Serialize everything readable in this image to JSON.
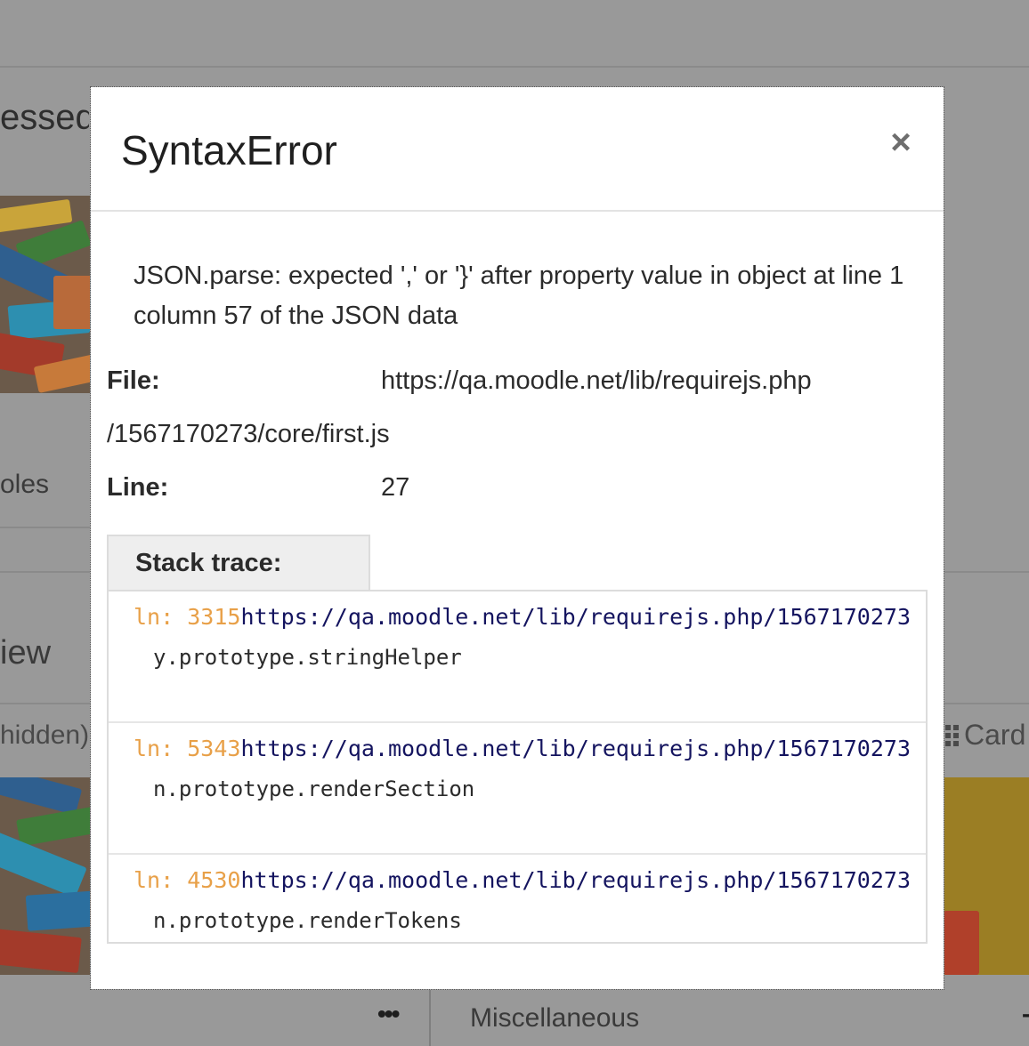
{
  "background": {
    "heading_fragment": "essed c",
    "roles_fragment": "oles",
    "overview_fragment": "iew",
    "hidden_fragment": "hidden)",
    "card_label": "Card",
    "misc_label": "Miscellaneous",
    "dots_label": "•••",
    "dash_label": "-"
  },
  "modal": {
    "title": "SyntaxError",
    "close_label": "×",
    "message": "JSON.parse: expected ',' or '}' after property value in object at line 1 column 57 of the JSON data",
    "file_label": "File:",
    "file_value_part1": "https://qa.moodle.net/lib/requirejs.php",
    "file_value_part2": "/1567170273/core/first.js",
    "line_label": "Line:",
    "line_value": "27",
    "stack_label": "Stack trace:",
    "stack": [
      {
        "prefix": "ln: ",
        "line": "3315",
        "url": "https://qa.moodle.net/lib/requirejs.php/1567170273",
        "fn": "y.prototype.stringHelper"
      },
      {
        "prefix": "ln: ",
        "line": "5343",
        "url": "https://qa.moodle.net/lib/requirejs.php/1567170273",
        "fn": "n.prototype.renderSection"
      },
      {
        "prefix": "ln: ",
        "line": "4530",
        "url": "https://qa.moodle.net/lib/requirejs.php/1567170273",
        "fn": "n.prototype.renderTokens"
      }
    ]
  },
  "colors": {
    "overlay": "#999999",
    "line_number": "#e8a048",
    "url": "#14145f"
  }
}
